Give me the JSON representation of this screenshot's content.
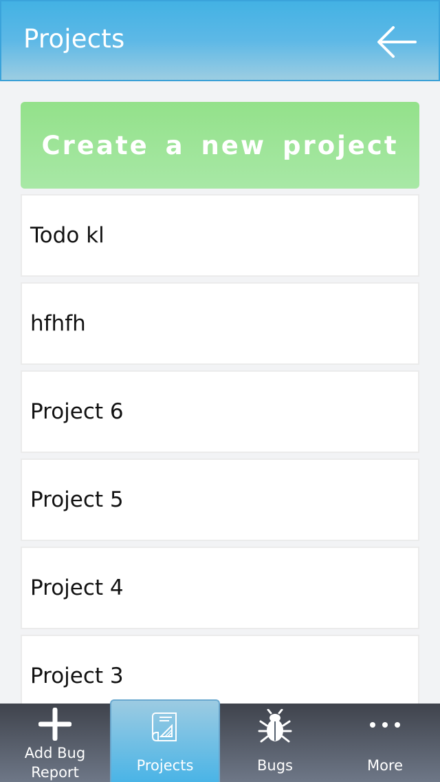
{
  "header": {
    "title": "Projects",
    "back_icon": "arrow-left-icon"
  },
  "create_button": {
    "label": "Create a new project"
  },
  "projects": [
    {
      "name": "Todo kl"
    },
    {
      "name": "hfhfh"
    },
    {
      "name": "Project 6"
    },
    {
      "name": "Project 5"
    },
    {
      "name": "Project 4"
    },
    {
      "name": "Project 3"
    }
  ],
  "tabbar": {
    "tabs": [
      {
        "label": "Add Bug\nReport",
        "icon": "plus-icon"
      },
      {
        "label": "Projects",
        "icon": "blueprint-icon",
        "active": true
      },
      {
        "label": "Bugs",
        "icon": "bug-icon"
      },
      {
        "label": "More",
        "icon": "more-dots-icon"
      }
    ]
  },
  "colors": {
    "header": "#43b2e4",
    "create_button": "#9be48f",
    "tabbar": "#3f434c",
    "active_tab": "#4ab4e6"
  }
}
